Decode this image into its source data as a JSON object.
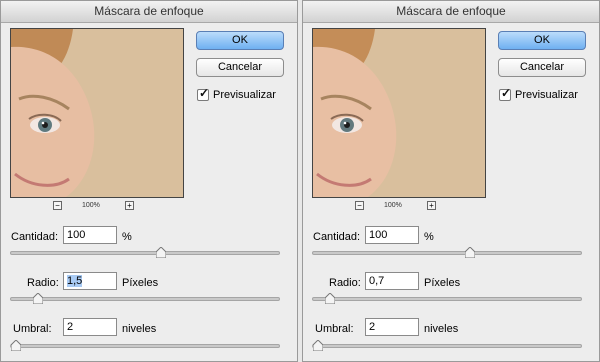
{
  "dialogs": [
    {
      "title": "Máscara de enfoque",
      "ok_label": "OK",
      "cancel_label": "Cancelar",
      "preview_checkbox": {
        "label": "Previsualizar",
        "checked": true
      },
      "zoom": "100%",
      "cantidad": {
        "label": "Cantidad:",
        "value": "100",
        "unit": "%",
        "slider_fraction": 0.5
      },
      "radio": {
        "label": "Radio:",
        "value": "1,5",
        "unit": "Píxeles",
        "slider_fraction": 0.09
      },
      "umbral": {
        "label": "Umbral:",
        "value": "2",
        "unit": "niveles",
        "slider_fraction": 0.0
      }
    },
    {
      "title": "Máscara de enfoque",
      "ok_label": "OK",
      "cancel_label": "Cancelar",
      "preview_checkbox": {
        "label": "Previsualizar",
        "checked": true
      },
      "zoom": "100%",
      "cantidad": {
        "label": "Cantidad:",
        "value": "100",
        "unit": "%",
        "slider_fraction": 0.5
      },
      "radio": {
        "label": "Radio:",
        "value": "0,7",
        "unit": "Píxeles",
        "slider_fraction": 0.01
      },
      "umbral": {
        "label": "Umbral:",
        "value": "2",
        "unit": "niveles",
        "slider_fraction": 0.0
      }
    }
  ],
  "colors": {
    "default_button": "#6fb0f1",
    "selection": "#a9cbf4",
    "skin": "#dcc3a2"
  },
  "icons": {
    "check": "checkmark-icon",
    "zoom_out": "zoom-out-icon",
    "zoom_in": "zoom-in-icon"
  }
}
